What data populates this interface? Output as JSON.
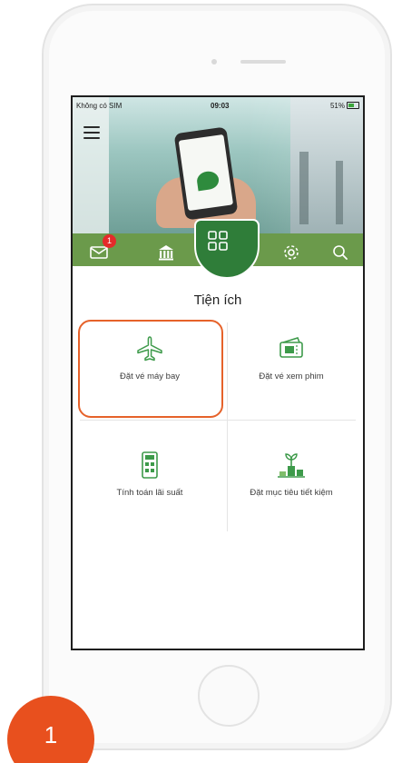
{
  "status_bar": {
    "carrier": "Không có SIM",
    "time": "09:03",
    "battery": "51%"
  },
  "nav": {
    "badge_count": "1",
    "icons": [
      "mail-icon",
      "bank-icon",
      "apps-grid-icon",
      "settings-gear-icon",
      "search-icon"
    ],
    "bar_color": "#6b9a4b",
    "active_color": "#2f7d39"
  },
  "page": {
    "title": "Tiện ích"
  },
  "tiles": [
    {
      "label": "Đặt vé máy bay",
      "icon": "airplane-icon"
    },
    {
      "label": "Đặt vé xem phim",
      "icon": "movie-ticket-icon"
    },
    {
      "label": "Tính toán lãi suất",
      "icon": "calculator-icon"
    },
    {
      "label": "Đặt mục tiêu tiết kiệm",
      "icon": "savings-plant-icon"
    }
  ],
  "step": {
    "number": "1",
    "color": "#e8501e"
  },
  "highlight_color": "#e6622a"
}
